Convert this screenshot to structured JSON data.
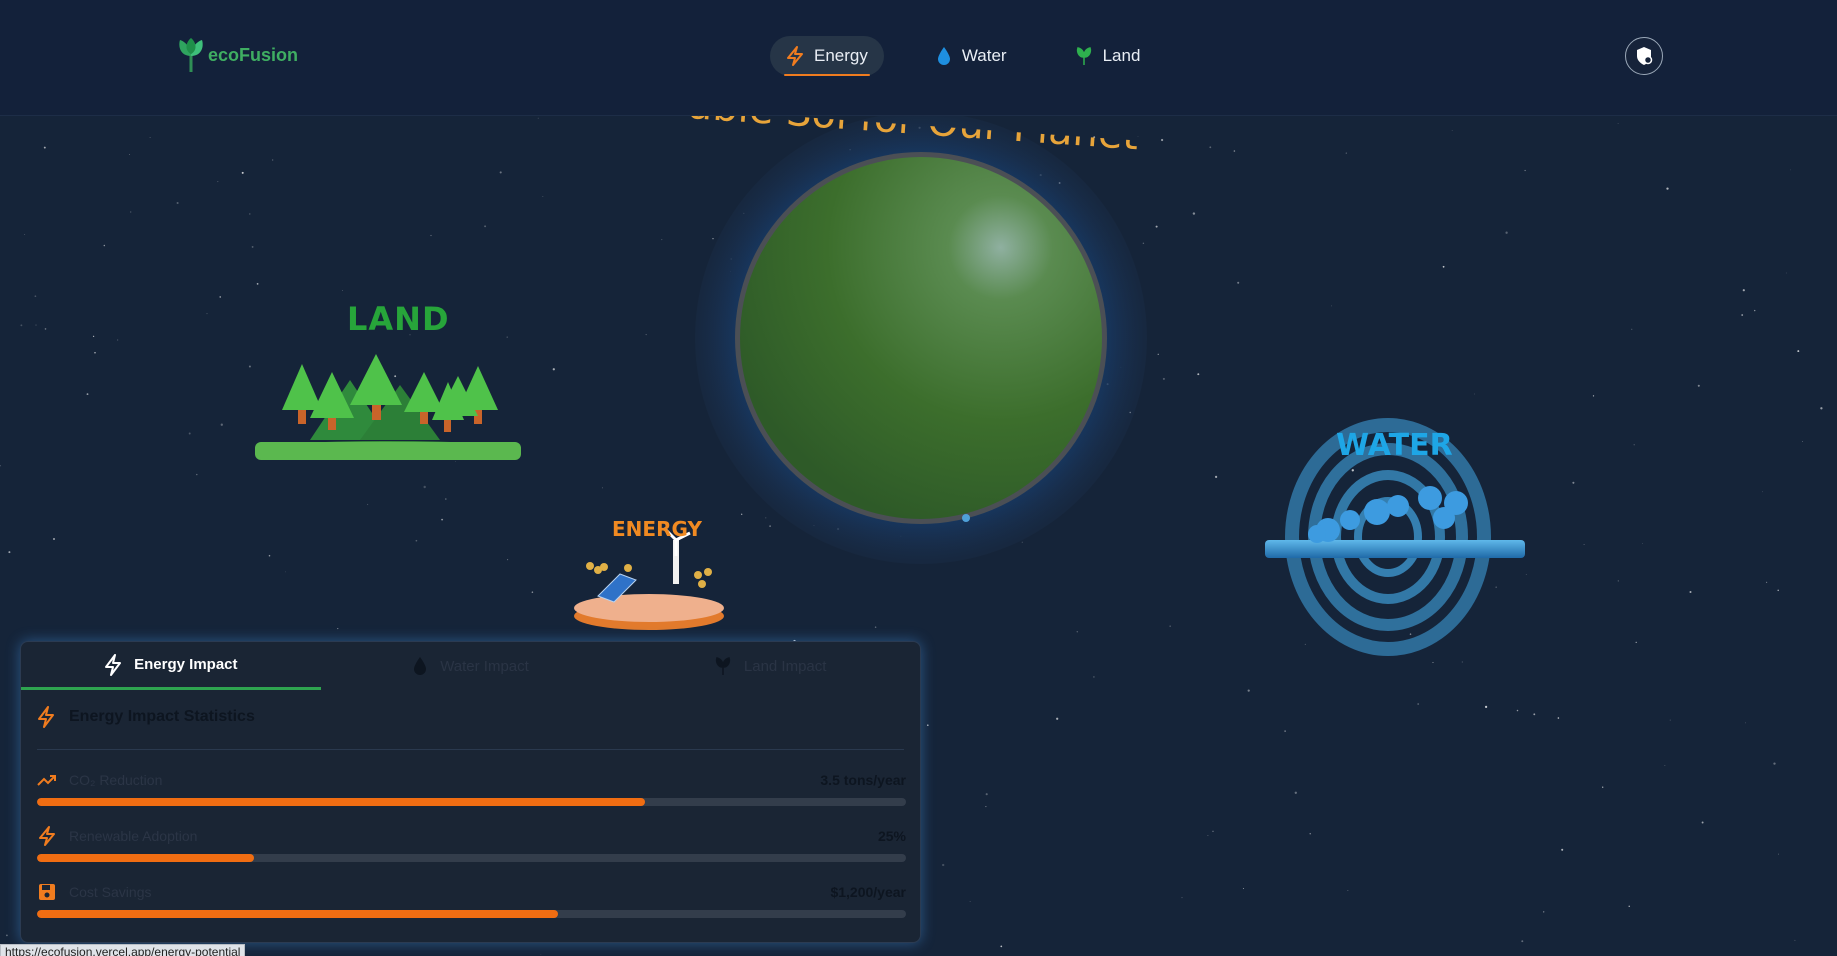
{
  "brand": {
    "name": "ecoFusion"
  },
  "nav": {
    "items": [
      {
        "label": "Energy",
        "icon": "lightning-icon",
        "active": true
      },
      {
        "label": "Water",
        "icon": "water-drop-icon",
        "active": false
      },
      {
        "label": "Land",
        "icon": "sprout-icon",
        "active": false
      }
    ]
  },
  "hero": {
    "headline": "able Sol    for Our Planet"
  },
  "scene": {
    "land_label": "LAND",
    "water_label": "WATER",
    "energy_label": "ENERGY"
  },
  "panel": {
    "tabs": [
      {
        "label": "Energy Impact",
        "icon": "lightning-icon",
        "active": true
      },
      {
        "label": "Water Impact",
        "icon": "water-drop-icon",
        "active": false
      },
      {
        "label": "Land Impact",
        "icon": "sprout-icon",
        "active": false
      }
    ],
    "title": "Energy Impact Statistics",
    "stats": [
      {
        "label": "CO₂ Reduction",
        "value": "3.5 tons/year",
        "icon": "trending-up-icon",
        "progress": 0.7
      },
      {
        "label": "Renewable Adoption",
        "value": "25%",
        "icon": "lightning-icon",
        "progress": 0.25
      },
      {
        "label": "Cost Savings",
        "value": "$1,200/year",
        "icon": "save-icon",
        "progress": 0.6
      }
    ]
  },
  "status_bar": {
    "url": "https://ecofusion.vercel.app/energy-potential"
  },
  "colors": {
    "energy": "#f06d12",
    "water": "#1ea6e6",
    "land": "#27a53a",
    "background": "#152439"
  }
}
